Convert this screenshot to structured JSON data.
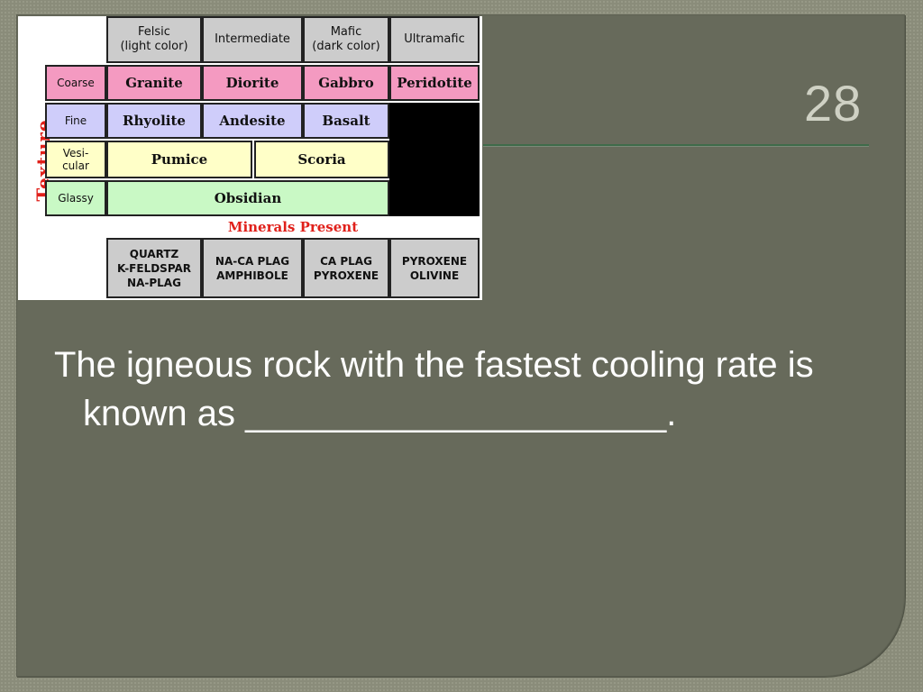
{
  "slide": {
    "number": "28",
    "question": "The igneous rock with the fastest cooling rate is known as _____________________."
  },
  "chart": {
    "columns": [
      "Felsic\n(light color)",
      "Intermediate",
      "Mafic\n(dark color)",
      "Ultramafic"
    ],
    "texture_label": "Texture",
    "rows": [
      {
        "label": "Coarse",
        "cells": [
          "Granite",
          "Diorite",
          "Gabbro",
          "Peridotite"
        ]
      },
      {
        "label": "Fine",
        "cells": [
          "Rhyolite",
          "Andesite",
          "Basalt"
        ]
      },
      {
        "label": "Vesi-\ncular",
        "cells": [
          "Pumice",
          "Scoria"
        ]
      },
      {
        "label": "Glassy",
        "cells": [
          "Obsidian"
        ]
      }
    ],
    "minerals_title": "Minerals Present",
    "minerals": [
      "QUARTZ\nK-FELDSPAR\nNA-PLAG",
      "NA-CA PLAG\nAMPHIBOLE",
      "CA PLAG\nPYROXENE",
      "PYROXENE\nOLIVINE"
    ],
    "colors": {
      "coarse": "#f49ac1",
      "fine": "#cfcdfa",
      "vesicular": "#ffffc8",
      "glassy": "#c9f9c5",
      "header": "#cccccc",
      "accent_red": "#e0201a"
    }
  }
}
